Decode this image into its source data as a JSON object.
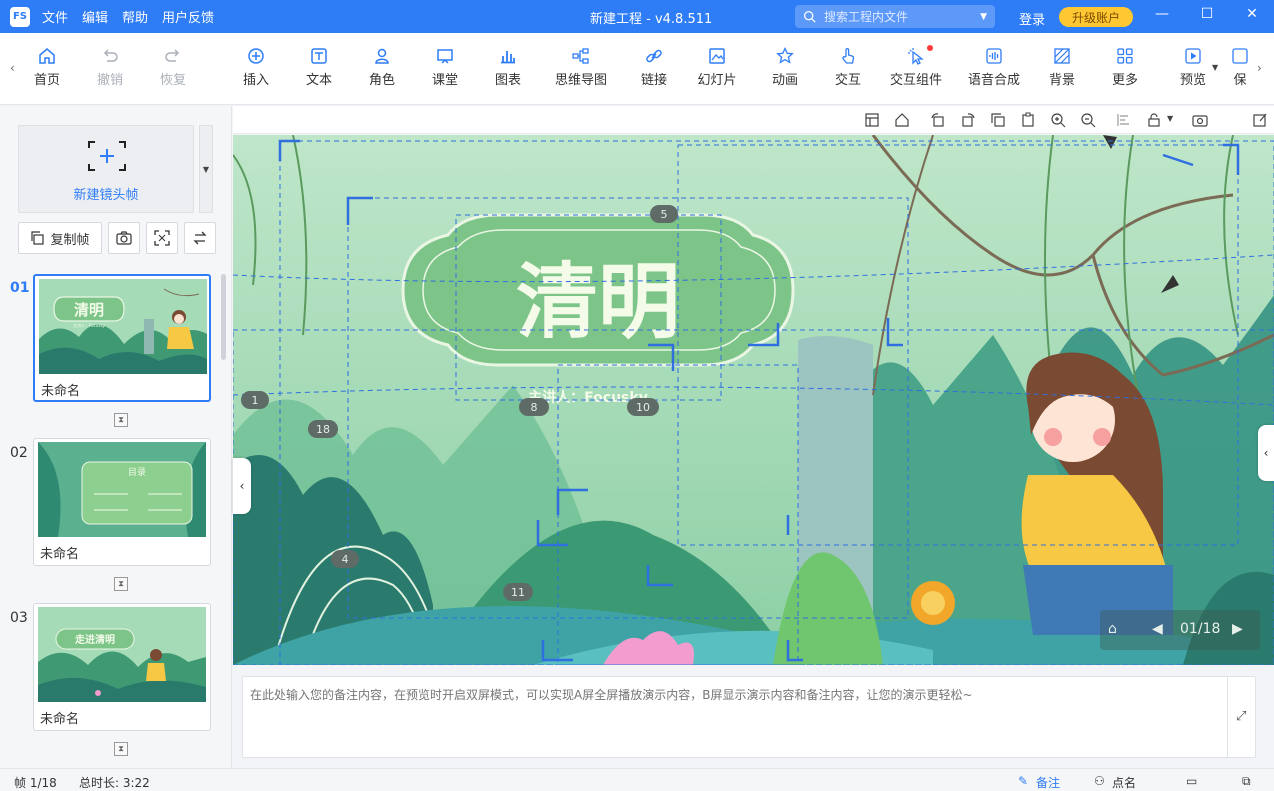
{
  "titlebar": {
    "logo": "FS",
    "menu": [
      "文件",
      "编辑",
      "帮助",
      "用户反馈"
    ],
    "title": "新建工程 - v4.8.511",
    "search_placeholder": "搜索工程内文件",
    "login": "登录",
    "upgrade": "升级账户"
  },
  "toolbar": {
    "items": [
      {
        "label": "首页",
        "icon": "home-icon"
      },
      {
        "label": "撤销",
        "icon": "undo-icon"
      },
      {
        "label": "恢复",
        "icon": "redo-icon"
      },
      {
        "label": "插入",
        "icon": "plus-circle-icon"
      },
      {
        "label": "文本",
        "icon": "text-icon"
      },
      {
        "label": "角色",
        "icon": "person-icon"
      },
      {
        "label": "课堂",
        "icon": "classroom-icon"
      },
      {
        "label": "图表",
        "icon": "chart-icon"
      },
      {
        "label": "思维导图",
        "icon": "mindmap-icon"
      },
      {
        "label": "链接",
        "icon": "link-icon"
      },
      {
        "label": "幻灯片",
        "icon": "slides-icon"
      },
      {
        "label": "动画",
        "icon": "star-icon"
      },
      {
        "label": "交互",
        "icon": "hand-icon"
      },
      {
        "label": "交互组件",
        "icon": "pointer-icon"
      },
      {
        "label": "语音合成",
        "icon": "voice-icon"
      },
      {
        "label": "背景",
        "icon": "background-icon"
      },
      {
        "label": "更多",
        "icon": "grid-icon"
      },
      {
        "label": "预览",
        "icon": "play-icon"
      },
      {
        "label": "保",
        "icon": "save-icon"
      }
    ]
  },
  "sidebar": {
    "new_frame": "新建镜头帧",
    "copy_frame": "复制帧",
    "slides": [
      {
        "num": "01",
        "name": "未命名",
        "title": "清明",
        "subtitle": "主讲人：Focusky"
      },
      {
        "num": "02",
        "name": "未命名",
        "title": "目录"
      },
      {
        "num": "03",
        "name": "未命名",
        "title": "走进清明"
      }
    ]
  },
  "canvas": {
    "title": "清明",
    "subtitle": "主讲人：Focusky",
    "frame_markers": [
      "5",
      "1",
      "18",
      "8",
      "10",
      "4",
      "11"
    ],
    "counter": "01/18"
  },
  "notes": {
    "placeholder": "在此处输入您的备注内容，在预览时开启双屏模式，可以实现A屏全屏播放演示内容，B屏显示演示内容和备注内容，让您的演示更轻松~"
  },
  "status": {
    "frame": "帧 1/18",
    "duration": "总时长: 3:22",
    "notes": "备注",
    "rollcall": "点名"
  },
  "colors": {
    "accent": "#2f7df6",
    "upgrade": "#ffc833",
    "slide_green": "#7cc488"
  }
}
